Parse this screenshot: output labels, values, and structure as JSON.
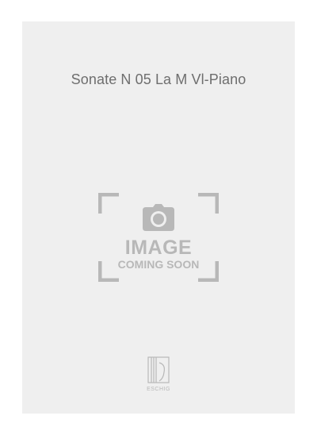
{
  "product": {
    "title": "Sonate N 05 La M Vl-Piano"
  },
  "placeholder": {
    "main_text": "IMAGE",
    "sub_text": "COMING SOON",
    "icon": "camera-icon"
  },
  "publisher": {
    "logo_text": "ESCHIG"
  },
  "colors": {
    "cover_background": "#efefef",
    "title_text": "#6e6e6e",
    "placeholder_gray": "#b8b8b8"
  }
}
